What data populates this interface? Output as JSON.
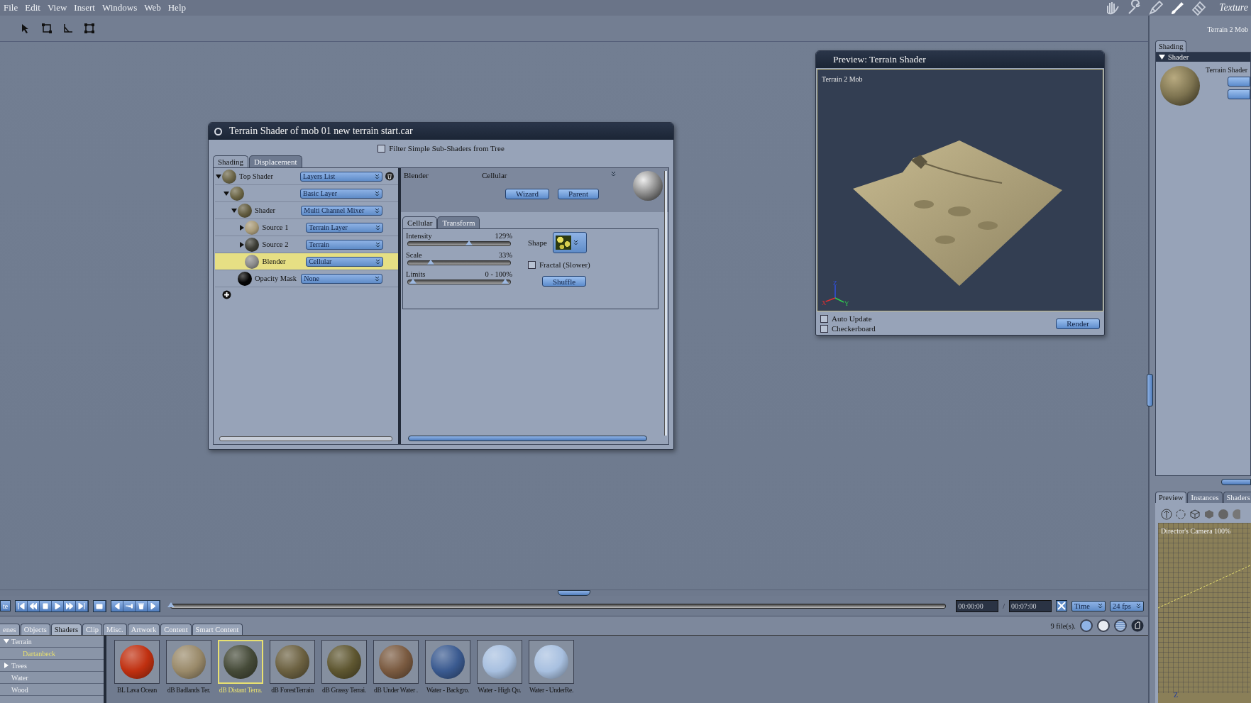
{
  "menu": [
    "File",
    "Edit",
    "View",
    "Insert",
    "Windows",
    "Web",
    "Help"
  ],
  "rooms": [
    {
      "kind": "hand",
      "selected": false
    },
    {
      "kind": "wrench",
      "selected": false
    },
    {
      "kind": "pen",
      "selected": false
    },
    {
      "kind": "brush",
      "selected": true
    },
    {
      "kind": "film",
      "selected": false
    }
  ],
  "room_title": "Texture",
  "shader_window": {
    "title": "Terrain Shader of mob 01 new terrain start.car",
    "filter_checkbox": {
      "label": "Filter Simple Sub-Shaders from Tree",
      "checked": false
    },
    "tabs": [
      {
        "label": "Shading",
        "selected": true
      },
      {
        "label": "Displacement",
        "selected": false
      }
    ],
    "tree": [
      {
        "label": "Top Shader",
        "type": "Layers List",
        "color": "#6b6547",
        "selected": false,
        "expanded": true,
        "children": [
          {
            "type": "Basic Layer",
            "color": "#6a6444",
            "selected": false,
            "expanded": true,
            "children": [
              {
                "label": "Shader",
                "type": "Multi Channel Mixer",
                "color": "#625c40",
                "selected": false,
                "expanded": true,
                "children": [
                  {
                    "label": "Source 1",
                    "type": "Terrain Layer",
                    "color": "#a89a78",
                    "selected": false,
                    "expanded": false
                  },
                  {
                    "label": "Source 2",
                    "type": "Terrain",
                    "color": "#3c3d35",
                    "selected": false,
                    "expanded": false
                  },
                  {
                    "label": "Blender",
                    "type": "Cellular",
                    "color": "#8a8a8a",
                    "selected": true
                  }
                ]
              },
              {
                "label": "Opacity Mask",
                "type": "None",
                "color": "#050505",
                "selected": false
              }
            ]
          }
        ]
      }
    ],
    "editor": {
      "name": "Blender",
      "type": "Cellular",
      "buttons": [
        "Wizard",
        "Parent"
      ],
      "tabs": [
        {
          "label": "Cellular",
          "selected": true
        },
        {
          "label": "Transform",
          "selected": false
        }
      ],
      "sliders": [
        {
          "label": "Intensity",
          "reading": "129%",
          "kind": "single",
          "level": 0.6
        },
        {
          "label": "Scale",
          "reading": "33%",
          "kind": "single",
          "level": 0.22
        },
        {
          "label": "Limits",
          "reading": "0 - 100%",
          "kind": "range",
          "level": 1
        }
      ],
      "shape_label": "Shape",
      "fractal_checkbox": {
        "label": "Fractal (Slower)",
        "checked": false
      },
      "shuffle_button": "Shuffle"
    }
  },
  "preview_window": {
    "title": "Preview: Terrain Shader",
    "viewport_label": "Terrain 2 Mob",
    "axes": [
      "Z",
      "X",
      "Y"
    ],
    "checkboxes": [
      {
        "label": "Auto Update",
        "checked": false
      },
      {
        "label": "Checkerboard",
        "checked": false
      }
    ],
    "render_button": "Render"
  },
  "right_panel": {
    "object_name": "Terrain 2 Mob",
    "tabs": [
      {
        "label": "Shading",
        "selected": true
      }
    ],
    "section": {
      "label": "Shader",
      "expanded": true
    },
    "shader_name": "Terrain Shader",
    "lower_tabs": [
      {
        "label": "Preview",
        "selected": true
      },
      {
        "label": "Instances",
        "selected": false
      },
      {
        "label": "Shaders",
        "selected": false
      }
    ],
    "camera_label": "Director's Camera 100%",
    "axis_label": "Z"
  },
  "timeline": {
    "left_button": "te",
    "level": 0,
    "current_time": "00:00:00",
    "separator": "/",
    "end_time": "00:07:00",
    "mode_dropdown": "Time",
    "fps_dropdown": "24 fps"
  },
  "browser": {
    "tabs": [
      {
        "label": "enes",
        "selected": false
      },
      {
        "label": "Objects",
        "selected": false
      },
      {
        "label": "Shaders",
        "selected": true
      },
      {
        "label": "Clip",
        "selected": false
      },
      {
        "label": "Misc.",
        "selected": false
      },
      {
        "label": "Artwork",
        "selected": false
      },
      {
        "label": "Content",
        "selected": false
      },
      {
        "label": "Smart Content",
        "selected": false
      }
    ],
    "file_count": "9 file(s).",
    "tree": [
      {
        "label": "Terrain",
        "selected": false,
        "expanded": true,
        "children": [
          {
            "label": "Dartanbeck",
            "selected": true
          }
        ]
      },
      {
        "label": "Trees",
        "selected": false,
        "expanded": false
      },
      {
        "label": "Water",
        "selected": false
      },
      {
        "label": "Wood",
        "selected": false
      }
    ],
    "items": [
      {
        "label": "BL Lava Ocean",
        "color": "#c03010",
        "selected": false
      },
      {
        "label": "dB Badlands Ter.",
        "color": "#9a8a6a",
        "selected": false
      },
      {
        "label": "dB Distant Terra.",
        "color": "#454a38",
        "selected": true
      },
      {
        "label": "dB ForestTerrain",
        "color": "#6b6040",
        "selected": false
      },
      {
        "label": "dB Grassy Terrai.",
        "color": "#5e5630",
        "selected": false
      },
      {
        "label": "dB Under Water .",
        "color": "#7a5a40",
        "selected": false
      },
      {
        "label": "Water - Backgro.",
        "color": "#3a5a90",
        "selected": false
      },
      {
        "label": "Water - High Qu.",
        "color": "#a8c0e0",
        "selected": false
      },
      {
        "label": "Water - UnderRe.",
        "color": "#a8c0e0",
        "selected": false
      }
    ]
  }
}
